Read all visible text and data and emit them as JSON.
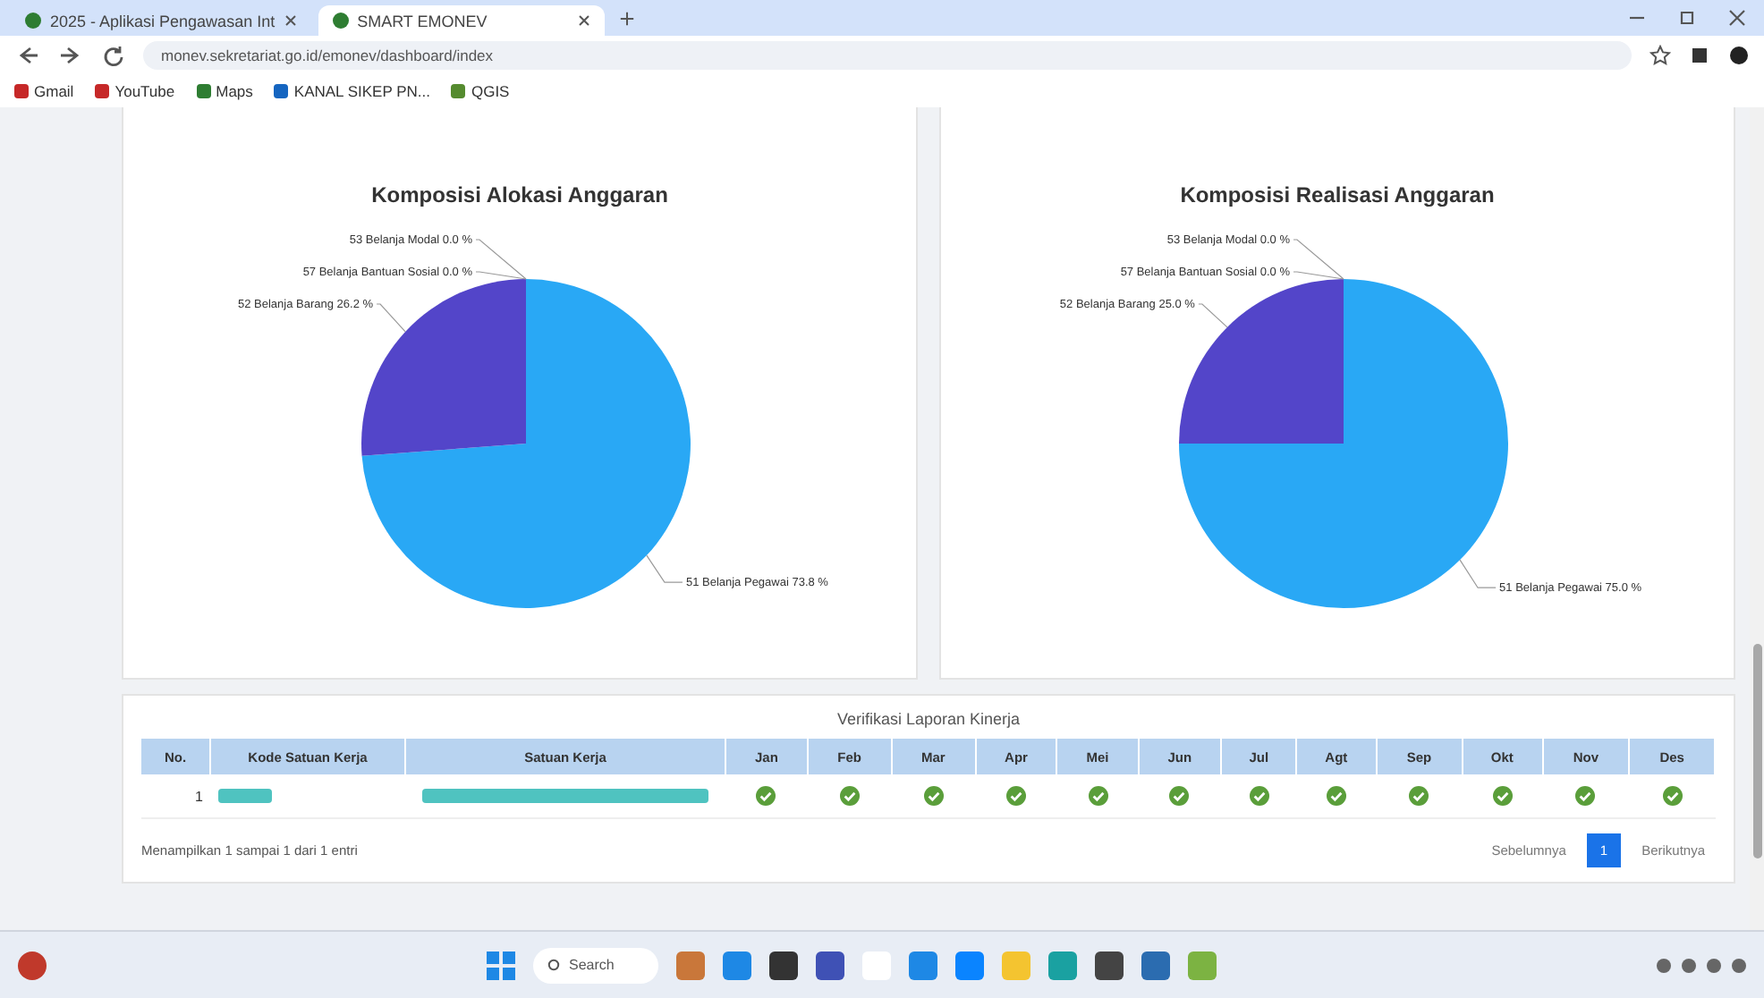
{
  "browser": {
    "tabs": [
      {
        "title": "2025 - Aplikasi Pengawasan Int",
        "selected": false
      },
      {
        "title": "SMART EMONEV",
        "selected": true
      }
    ],
    "url": "monev.sekretariat.go.id/emonev/dashboard/index",
    "bookmarks": [
      "Gmail",
      "YouTube",
      "Maps",
      "KANAL SIKEP PN...",
      "QGIS"
    ]
  },
  "charts": [
    {
      "title": "Komposisi Alokasi Anggaran",
      "chart_data": {
        "type": "pie",
        "categories": [
          "51 Belanja Pegawai",
          "52 Belanja Barang",
          "57 Belanja Bantuan Sosial",
          "53 Belanja Modal"
        ],
        "values": [
          73.8,
          26.2,
          0.0,
          0.0
        ],
        "data_labels": true,
        "value_labels": [
          "73.8 %",
          "26.2 %",
          "0.0 %",
          "0.0 %"
        ]
      }
    },
    {
      "title": "Komposisi Realisasi Anggaran",
      "chart_data": {
        "type": "pie",
        "categories": [
          "51 Belanja Pegawai",
          "52 Belanja Barang",
          "57 Belanja Bantuan Sosial",
          "53 Belanja Modal"
        ],
        "values": [
          75.0,
          25.0,
          0.0,
          0.0
        ],
        "data_labels": true,
        "value_labels": [
          "75.0 %",
          "25.0 %",
          "0.0 %",
          "0.0 %"
        ]
      }
    }
  ],
  "table": {
    "title": "Verifikasi Laporan Kinerja",
    "columns": [
      "No.",
      "Kode Satuan Kerja",
      "Satuan Kerja",
      "Jan",
      "Feb",
      "Mar",
      "Apr",
      "Mei",
      "Jun",
      "Jul",
      "Agt",
      "Sep",
      "Okt",
      "Nov",
      "Des"
    ],
    "rows": [
      {
        "no": "1",
        "months": [
          {
            "verified": true
          },
          {
            "verified": true
          },
          {
            "verified": true
          },
          {
            "verified": true
          },
          {
            "verified": true
          },
          {
            "verified": true
          },
          {
            "verified": true
          },
          {
            "verified": true
          },
          {
            "verified": true
          },
          {
            "verified": true
          },
          {
            "verified": true
          },
          {
            "verified": true
          }
        ]
      }
    ],
    "info": "Menampilkan 1 sampai 1 dari 1 entri",
    "pagination": [
      {
        "label": "Sebelumnya",
        "selected": false
      },
      {
        "label": "1",
        "selected": true
      },
      {
        "label": "Berikutnya",
        "selected": false
      }
    ]
  },
  "taskbar": {
    "search": "Search"
  }
}
